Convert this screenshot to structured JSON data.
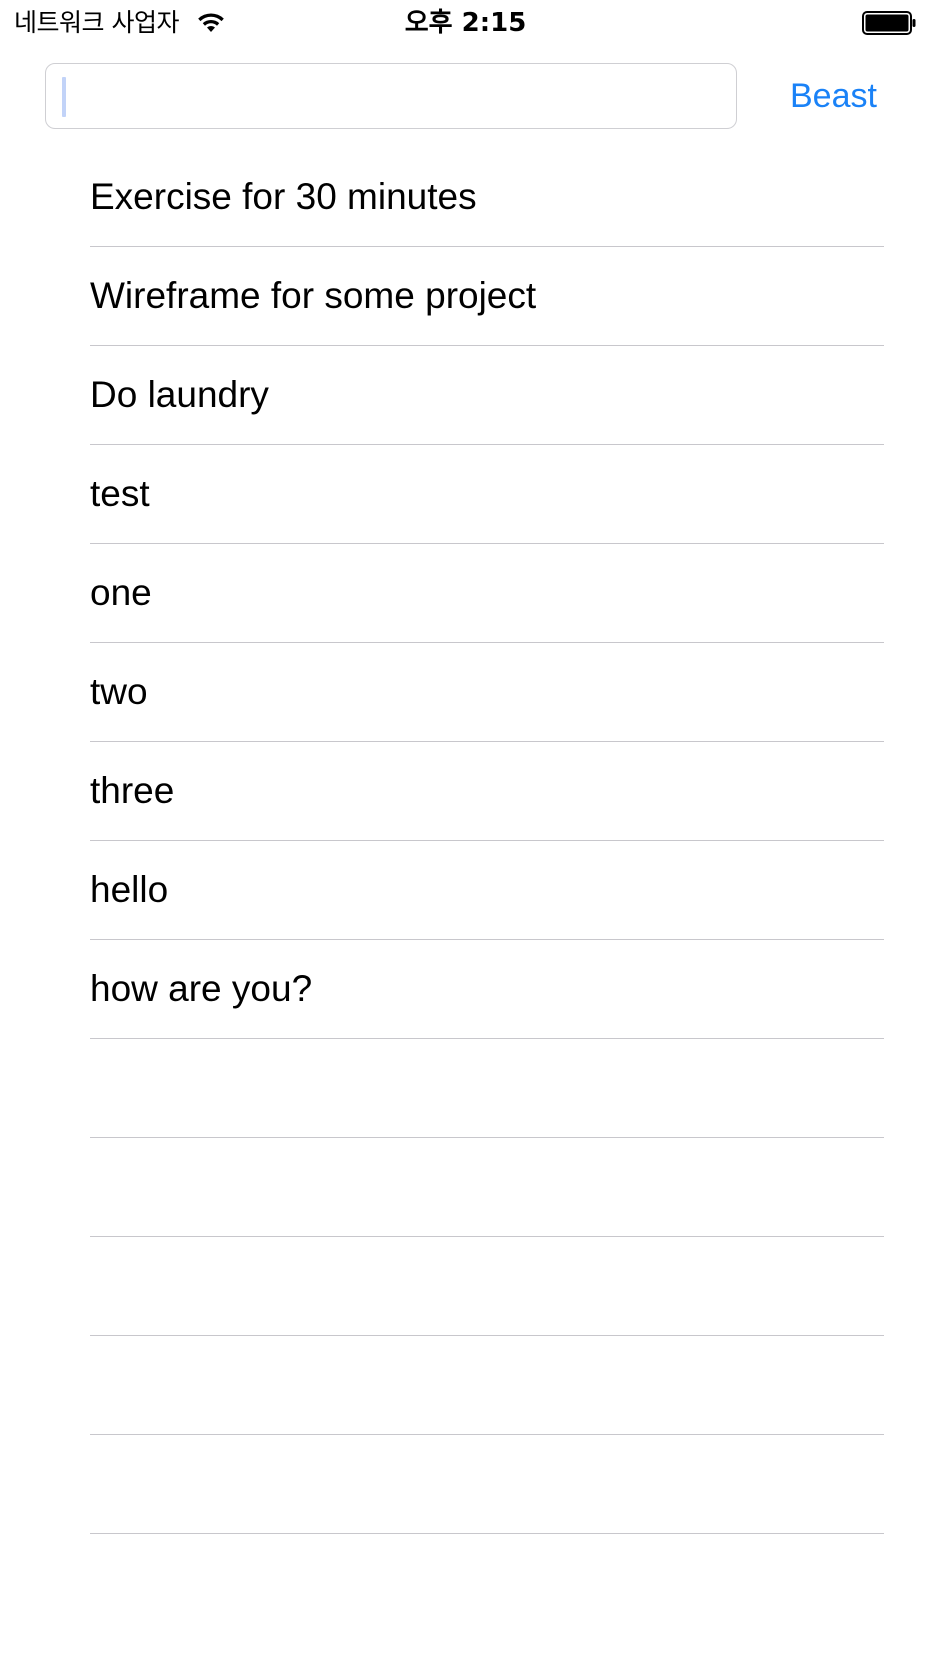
{
  "status_bar": {
    "carrier": "네트워크 사업자",
    "time": "오후 2:15",
    "wifi_icon": "wifi-icon",
    "battery_icon": "battery-full-icon"
  },
  "new_item": {
    "value": "",
    "placeholder": "",
    "add_label": "Beast"
  },
  "todos": [
    "Exercise for 30 minutes",
    "Wireframe for some project",
    "Do laundry",
    "test",
    "one",
    "two",
    "three",
    "hello",
    "how are you?",
    "",
    "",
    "",
    "",
    ""
  ],
  "colors": {
    "accent": "#1a82f7",
    "separator": "#c8c7cc",
    "caret": "#c2d3f8"
  }
}
